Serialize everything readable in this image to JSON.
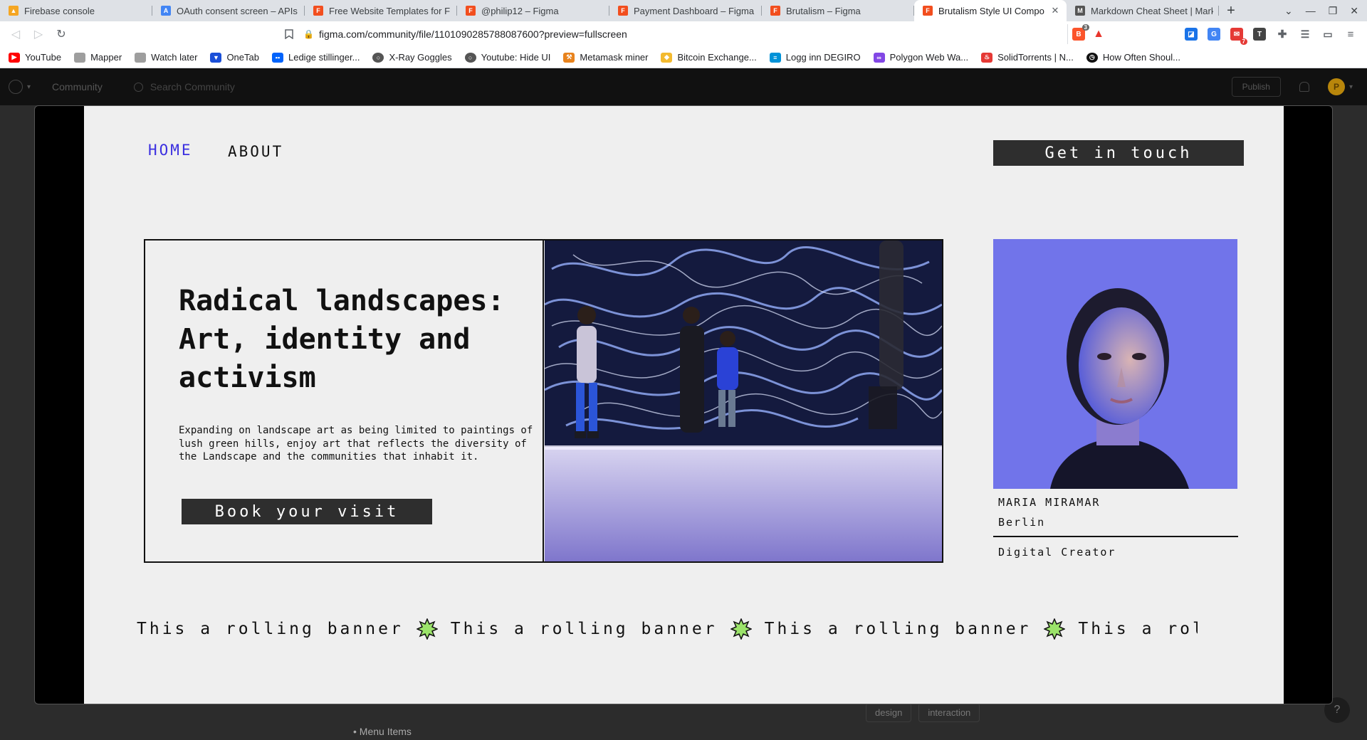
{
  "browser": {
    "tabs": [
      {
        "title": "Firebase console",
        "icon": "firebase-icon",
        "color": "#f5a623"
      },
      {
        "title": "OAuth consent screen – APIs a",
        "icon": "api-icon",
        "color": "#4285f4"
      },
      {
        "title": "Free Website Templates for F",
        "icon": "figma-icon",
        "color": "#f24e1e"
      },
      {
        "title": "@philip12 – Figma",
        "icon": "figma-icon",
        "color": "#f24e1e"
      },
      {
        "title": "Payment Dashboard – Figma",
        "icon": "figma-icon",
        "color": "#f24e1e"
      },
      {
        "title": "Brutalism – Figma",
        "icon": "figma-icon",
        "color": "#f24e1e"
      },
      {
        "title": "Brutalism Style UI Compo",
        "icon": "figma-icon",
        "color": "#f24e1e",
        "active": true
      },
      {
        "title": "Markdown Cheat Sheet | Mark",
        "icon": "markdown-icon",
        "color": "#555555"
      }
    ],
    "url": "figma.com/community/file/1101090285788087600?preview=fullscreen",
    "extension_badges": {
      "brave": "3",
      "mail": "7"
    },
    "bookmarks": [
      {
        "label": "YouTube",
        "icon": "youtube-icon",
        "color": "#ff0000"
      },
      {
        "label": "Mapper",
        "icon": "folder-icon",
        "color": "#9e9e9e"
      },
      {
        "label": "Watch later",
        "icon": "folder-icon",
        "color": "#9e9e9e"
      },
      {
        "label": "OneTab",
        "icon": "onetab-icon",
        "color": "#1a4fd8"
      },
      {
        "label": "Ledige stillinger...",
        "icon": "finn-icon",
        "color": "#0063fb"
      },
      {
        "label": "X-Ray Goggles",
        "icon": "globe-icon",
        "color": "#555555"
      },
      {
        "label": "Youtube: Hide UI",
        "icon": "globe-icon",
        "color": "#555555"
      },
      {
        "label": "Metamask miner",
        "icon": "pickaxe-icon",
        "color": "#e8831d"
      },
      {
        "label": "Bitcoin Exchange...",
        "icon": "binance-icon",
        "color": "#f3ba2f"
      },
      {
        "label": "Logg inn DEGIRO",
        "icon": "degiro-icon",
        "color": "#0092d8"
      },
      {
        "label": "Polygon Web Wa...",
        "icon": "polygon-icon",
        "color": "#8247e5"
      },
      {
        "label": "SolidTorrents | N...",
        "icon": "flame-icon",
        "color": "#e53935"
      },
      {
        "label": "How Often Shoul...",
        "icon": "clock-icon",
        "color": "#111111"
      }
    ]
  },
  "figma": {
    "section": "Community",
    "search_placeholder": "Search Community",
    "publish_label": "Publish",
    "avatar_letter": "P",
    "tags": [
      "design",
      "interaction"
    ],
    "menu_item": "• Menu Items",
    "help": "?"
  },
  "site": {
    "nav": {
      "home": "HOME",
      "about": "ABOUT"
    },
    "cta": "Get in touch",
    "hero": {
      "title": "Radical landscapes: Art, identity and activism",
      "description": "Expanding on landscape art as being limited to paintings of lush green hills, enjoy art that reflects the diversity of the Landscape and the communities that inhabit it.",
      "button": "Book your visit"
    },
    "profile": {
      "name": "MARIA MIRAMAR",
      "city": "Berlin",
      "role": "Digital Creator"
    },
    "banner": {
      "segments": [
        "This a rolling banner",
        "This a rolling banner",
        "This a rolling banner",
        "This a rolling bar"
      ]
    }
  },
  "colors": {
    "accent": "#3b2fe0",
    "button_bg": "#2e2e2e",
    "canvas_bg": "#efefef",
    "star_fill": "#9be36a"
  }
}
